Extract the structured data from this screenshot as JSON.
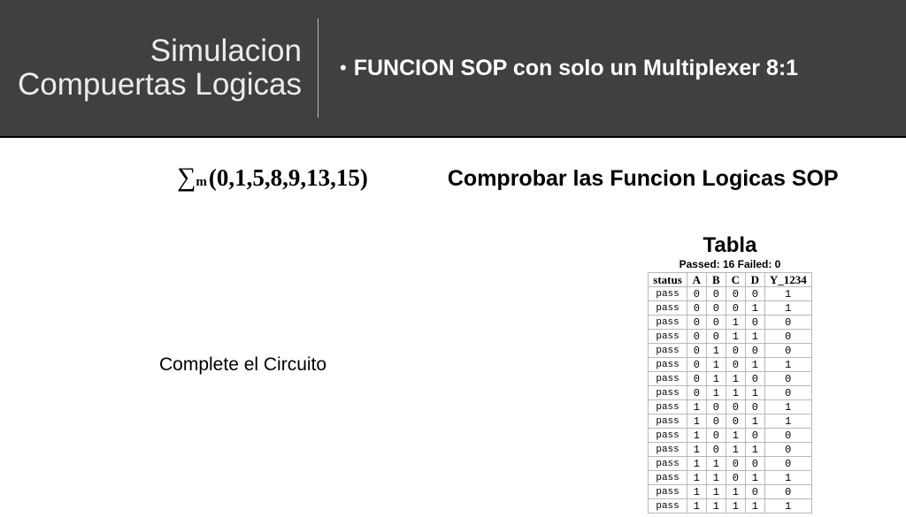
{
  "header": {
    "title_line1": "Simulacion",
    "title_line2": "Compuertas Logicas",
    "subtitle": "FUNCION SOP con solo un Multiplexer 8:1"
  },
  "sigma": {
    "symbol": "∑",
    "subscript": "m",
    "args": "(0,1,5,8,9,13,15)"
  },
  "check_title": "Comprobar las Funcion  Logicas SOP",
  "complete_label": "Complete el Circuito",
  "table": {
    "title": "Tabla",
    "summary": "Passed: 16 Failed: 0",
    "headers": [
      "status",
      "A",
      "B",
      "C",
      "D",
      "Y_1234"
    ],
    "rows": [
      {
        "status": "pass",
        "A": "0",
        "B": "0",
        "C": "0",
        "D": "0",
        "Y": "1"
      },
      {
        "status": "pass",
        "A": "0",
        "B": "0",
        "C": "0",
        "D": "1",
        "Y": "1"
      },
      {
        "status": "pass",
        "A": "0",
        "B": "0",
        "C": "1",
        "D": "0",
        "Y": "0"
      },
      {
        "status": "pass",
        "A": "0",
        "B": "0",
        "C": "1",
        "D": "1",
        "Y": "0"
      },
      {
        "status": "pass",
        "A": "0",
        "B": "1",
        "C": "0",
        "D": "0",
        "Y": "0"
      },
      {
        "status": "pass",
        "A": "0",
        "B": "1",
        "C": "0",
        "D": "1",
        "Y": "1"
      },
      {
        "status": "pass",
        "A": "0",
        "B": "1",
        "C": "1",
        "D": "0",
        "Y": "0"
      },
      {
        "status": "pass",
        "A": "0",
        "B": "1",
        "C": "1",
        "D": "1",
        "Y": "0"
      },
      {
        "status": "pass",
        "A": "1",
        "B": "0",
        "C": "0",
        "D": "0",
        "Y": "1"
      },
      {
        "status": "pass",
        "A": "1",
        "B": "0",
        "C": "0",
        "D": "1",
        "Y": "1"
      },
      {
        "status": "pass",
        "A": "1",
        "B": "0",
        "C": "1",
        "D": "0",
        "Y": "0"
      },
      {
        "status": "pass",
        "A": "1",
        "B": "0",
        "C": "1",
        "D": "1",
        "Y": "0"
      },
      {
        "status": "pass",
        "A": "1",
        "B": "1",
        "C": "0",
        "D": "0",
        "Y": "0"
      },
      {
        "status": "pass",
        "A": "1",
        "B": "1",
        "C": "0",
        "D": "1",
        "Y": "1"
      },
      {
        "status": "pass",
        "A": "1",
        "B": "1",
        "C": "1",
        "D": "0",
        "Y": "0"
      },
      {
        "status": "pass",
        "A": "1",
        "B": "1",
        "C": "1",
        "D": "1",
        "Y": "1"
      }
    ]
  }
}
